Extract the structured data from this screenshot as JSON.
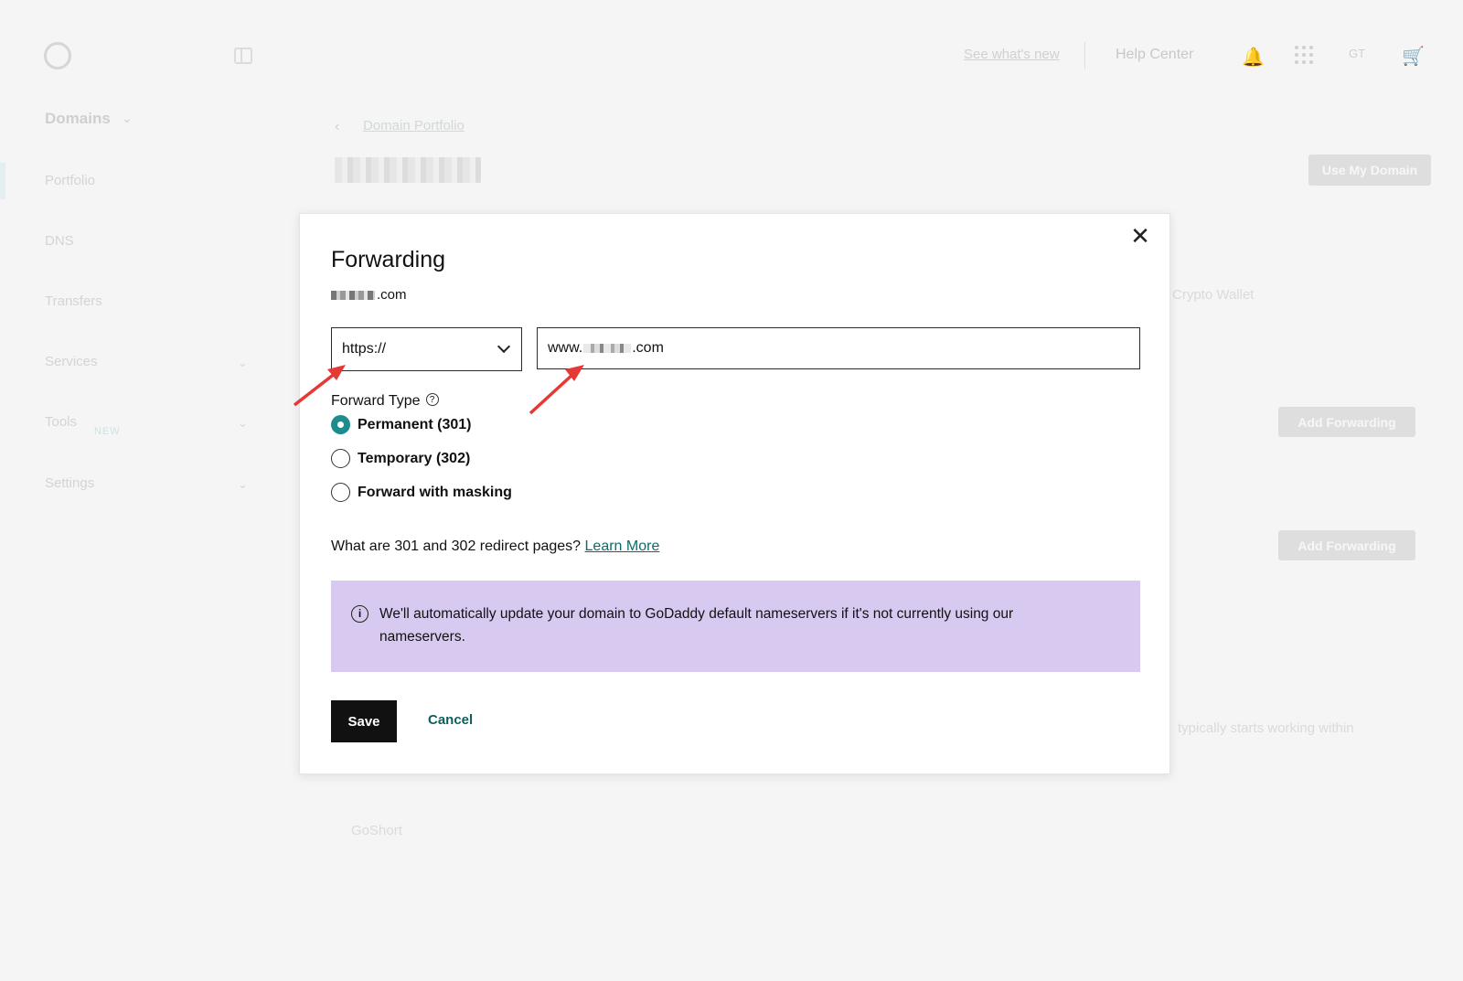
{
  "header": {
    "see_whats_new": "See what's new",
    "help_center": "Help Center",
    "user_initials": "GT"
  },
  "sidebar": {
    "section_title": "Domains",
    "items": [
      {
        "label": "Portfolio"
      },
      {
        "label": "DNS"
      },
      {
        "label": "Transfers"
      },
      {
        "label": "Services"
      },
      {
        "label": "Tools"
      },
      {
        "label": "Settings"
      }
    ],
    "tools_badge": "NEW"
  },
  "main": {
    "breadcrumb": "Domain Portfolio",
    "use_my_domain": "Use My Domain",
    "crypto_wallet": "Crypto Wallet",
    "add_forwarding_1": "Add Forwarding",
    "add_forwarding_2": "Add Forwarding",
    "working_text": "typically starts working within",
    "goshort": "GoShort"
  },
  "modal": {
    "title": "Forwarding",
    "domain_suffix": ".com",
    "protocol": "https://",
    "url_prefix": "www.",
    "url_suffix": ".com",
    "forward_type_label": "Forward Type",
    "options": [
      {
        "label": "Permanent (301)",
        "checked": true
      },
      {
        "label": "Temporary (302)",
        "checked": false
      },
      {
        "label": "Forward with masking",
        "checked": false
      }
    ],
    "learn_prefix": "What are 301 and 302 redirect pages?",
    "learn_link": "Learn More",
    "info_text": "We'll automatically update your domain to GoDaddy default nameservers if it's not currently using our nameservers.",
    "save_label": "Save",
    "cancel_label": "Cancel"
  },
  "colors": {
    "accent": "#1e8c8c",
    "banner": "#d8c9f1",
    "arrow": "#e53935"
  }
}
